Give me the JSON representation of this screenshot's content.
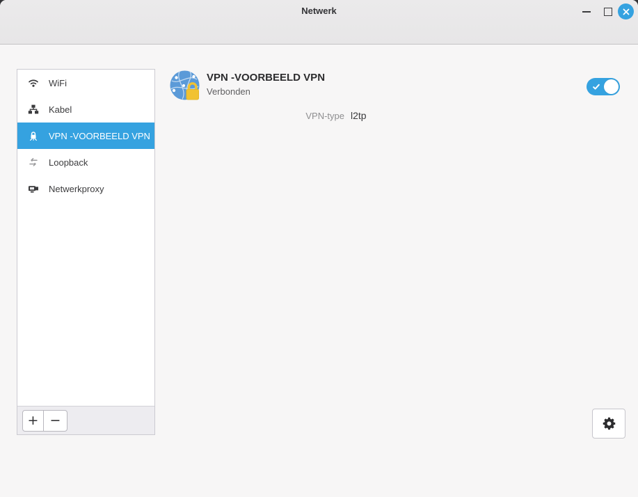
{
  "window": {
    "title": "Netwerk"
  },
  "sidebar": {
    "items": [
      {
        "label": "WiFi",
        "icon": "wifi-icon",
        "selected": false
      },
      {
        "label": "Kabel",
        "icon": "wired-network-icon",
        "selected": false
      },
      {
        "label": "VPN -VOORBEELD VPN",
        "icon": "vpn-lock-icon",
        "selected": true
      },
      {
        "label": "Loopback",
        "icon": "loopback-arrows-icon",
        "selected": false
      },
      {
        "label": "Netwerkproxy",
        "icon": "network-proxy-icon",
        "selected": false
      }
    ],
    "toolbar": {
      "add": "+",
      "remove": "−"
    }
  },
  "main": {
    "connection": {
      "name": "VPN -VOORBEELD VPN",
      "status": "Verbonden",
      "switch_on": true
    },
    "details": [
      {
        "label": "VPN-type",
        "value": "l2tp"
      }
    ]
  },
  "colors": {
    "accent": "#35a2e0",
    "titlebar_bg": "#e9e8e9",
    "content_bg": "#f7f6f6",
    "globe_blue": "#5b9ad8",
    "lock_yellow": "#f1c232"
  }
}
